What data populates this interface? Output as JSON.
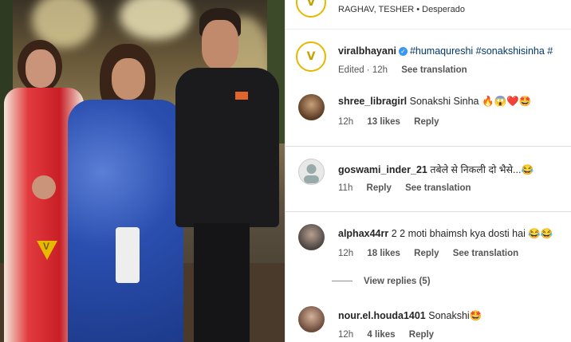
{
  "header": {
    "subtitle": "RAGHAV, TESHER • Desperado"
  },
  "caption": {
    "username": "viralbhayani",
    "text": "#humaqureshi #sonakshisinha #",
    "time": "Edited · 12h",
    "see_translation": "See translation"
  },
  "comments": [
    {
      "username": "shree_libragirl",
      "text": "Sonakshi Sinha 🔥😱❤️🤩",
      "time": "12h",
      "likes": "13 likes",
      "reply": "Reply"
    },
    {
      "username": "goswami_inder_21",
      "text": "तबेले से निकली दो भैसे...😂",
      "time": "11h",
      "reply": "Reply",
      "see_translation": "See translation"
    },
    {
      "username": "alphax44rr",
      "text": "2 2 moti bhaimsh kya dosti hai 😂😂",
      "time": "12h",
      "likes": "18 likes",
      "reply": "Reply",
      "see_translation": "See translation",
      "view_replies": "View replies (5)"
    },
    {
      "username": "nour.el.houda1401",
      "text": "Sonakshi🤩",
      "time": "12h",
      "likes": "4 likes",
      "reply": "Reply"
    }
  ],
  "photo": {
    "watermark": "V"
  },
  "colors": {
    "verified": "#3897f0",
    "logo_gold": "#e6b800",
    "dress_red": "#d8262a",
    "dress_blue": "#2a4fb0"
  }
}
